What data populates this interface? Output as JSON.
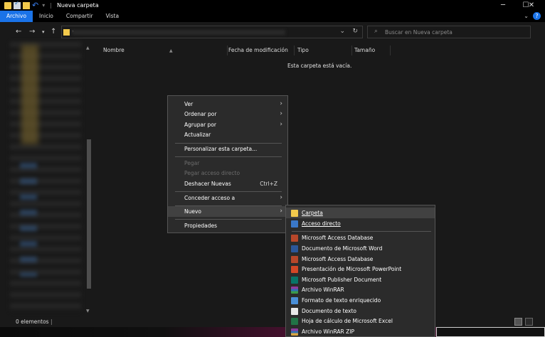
{
  "window": {
    "title": "Nueva carpeta"
  },
  "ribbon": {
    "tabs": [
      "Archivo",
      "Inicio",
      "Compartir",
      "Vista"
    ],
    "active": "Archivo"
  },
  "address": {
    "separator": "›"
  },
  "search": {
    "placeholder": "Buscar en Nueva carpeta"
  },
  "columns": {
    "name": "Nombre",
    "date": "Fecha de modificación",
    "type": "Tipo",
    "size": "Tamaño"
  },
  "content": {
    "empty_message": "Esta carpeta está vacía."
  },
  "status": {
    "items": "0 elementos"
  },
  "context_menu": {
    "ver": "Ver",
    "ordenar": "Ordenar por",
    "agrupar": "Agrupar por",
    "actualizar": "Actualizar",
    "personalizar": "Personalizar esta carpeta...",
    "pegar": "Pegar",
    "pegar_acceso": "Pegar acceso directo",
    "deshacer": "Deshacer Nuevas",
    "deshacer_shortcut": "Ctrl+Z",
    "conceder": "Conceder acceso a",
    "nuevo": "Nuevo",
    "propiedades": "Propiedades"
  },
  "new_submenu": {
    "carpeta": "Carpeta",
    "acceso_directo": "Acceso directo",
    "items": [
      "Microsoft Access Database",
      "Documento de Microsoft Word",
      "Microsoft Access Database",
      "Presentación de Microsoft PowerPoint",
      "Microsoft Publisher Document",
      "Archivo WinRAR",
      "Formato de texto enriquecido",
      "Documento de texto",
      "Hoja de cálculo de Microsoft Excel",
      "Archivo WinRAR ZIP"
    ]
  },
  "colors": {
    "accent": "#1a73e8",
    "menu_bg": "#2b2b2b",
    "window_bg": "#191919"
  }
}
